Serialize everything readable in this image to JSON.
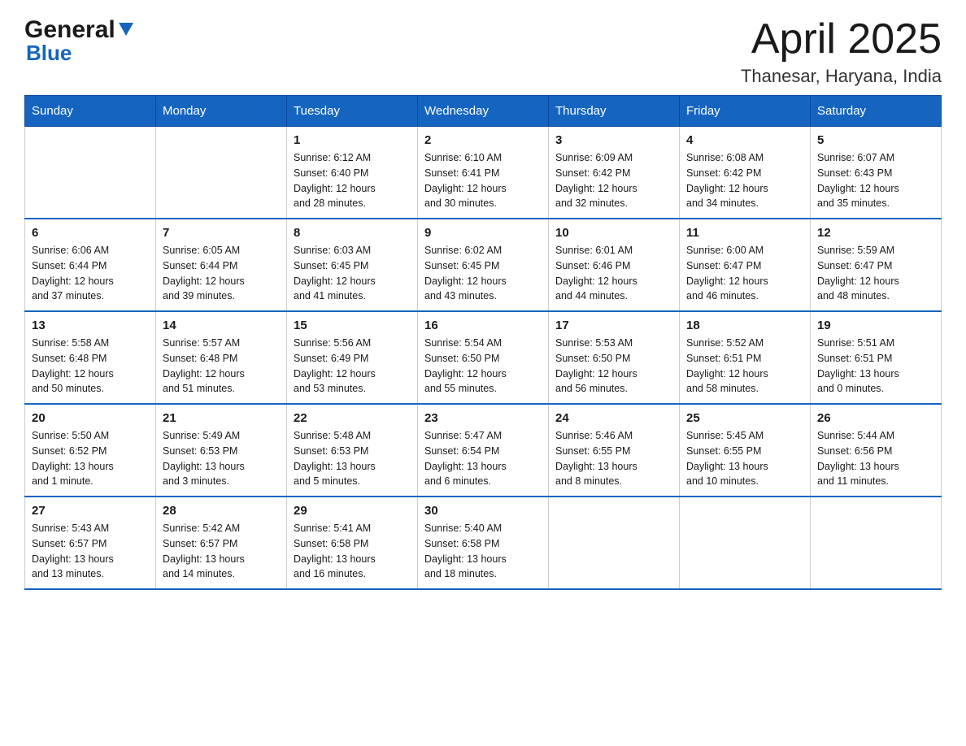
{
  "header": {
    "logo_general": "General",
    "logo_blue": "Blue",
    "title": "April 2025",
    "subtitle": "Thanesar, Haryana, India"
  },
  "calendar": {
    "days_of_week": [
      "Sunday",
      "Monday",
      "Tuesday",
      "Wednesday",
      "Thursday",
      "Friday",
      "Saturday"
    ],
    "weeks": [
      [
        {
          "day": "",
          "info": ""
        },
        {
          "day": "",
          "info": ""
        },
        {
          "day": "1",
          "info": "Sunrise: 6:12 AM\nSunset: 6:40 PM\nDaylight: 12 hours\nand 28 minutes."
        },
        {
          "day": "2",
          "info": "Sunrise: 6:10 AM\nSunset: 6:41 PM\nDaylight: 12 hours\nand 30 minutes."
        },
        {
          "day": "3",
          "info": "Sunrise: 6:09 AM\nSunset: 6:42 PM\nDaylight: 12 hours\nand 32 minutes."
        },
        {
          "day": "4",
          "info": "Sunrise: 6:08 AM\nSunset: 6:42 PM\nDaylight: 12 hours\nand 34 minutes."
        },
        {
          "day": "5",
          "info": "Sunrise: 6:07 AM\nSunset: 6:43 PM\nDaylight: 12 hours\nand 35 minutes."
        }
      ],
      [
        {
          "day": "6",
          "info": "Sunrise: 6:06 AM\nSunset: 6:44 PM\nDaylight: 12 hours\nand 37 minutes."
        },
        {
          "day": "7",
          "info": "Sunrise: 6:05 AM\nSunset: 6:44 PM\nDaylight: 12 hours\nand 39 minutes."
        },
        {
          "day": "8",
          "info": "Sunrise: 6:03 AM\nSunset: 6:45 PM\nDaylight: 12 hours\nand 41 minutes."
        },
        {
          "day": "9",
          "info": "Sunrise: 6:02 AM\nSunset: 6:45 PM\nDaylight: 12 hours\nand 43 minutes."
        },
        {
          "day": "10",
          "info": "Sunrise: 6:01 AM\nSunset: 6:46 PM\nDaylight: 12 hours\nand 44 minutes."
        },
        {
          "day": "11",
          "info": "Sunrise: 6:00 AM\nSunset: 6:47 PM\nDaylight: 12 hours\nand 46 minutes."
        },
        {
          "day": "12",
          "info": "Sunrise: 5:59 AM\nSunset: 6:47 PM\nDaylight: 12 hours\nand 48 minutes."
        }
      ],
      [
        {
          "day": "13",
          "info": "Sunrise: 5:58 AM\nSunset: 6:48 PM\nDaylight: 12 hours\nand 50 minutes."
        },
        {
          "day": "14",
          "info": "Sunrise: 5:57 AM\nSunset: 6:48 PM\nDaylight: 12 hours\nand 51 minutes."
        },
        {
          "day": "15",
          "info": "Sunrise: 5:56 AM\nSunset: 6:49 PM\nDaylight: 12 hours\nand 53 minutes."
        },
        {
          "day": "16",
          "info": "Sunrise: 5:54 AM\nSunset: 6:50 PM\nDaylight: 12 hours\nand 55 minutes."
        },
        {
          "day": "17",
          "info": "Sunrise: 5:53 AM\nSunset: 6:50 PM\nDaylight: 12 hours\nand 56 minutes."
        },
        {
          "day": "18",
          "info": "Sunrise: 5:52 AM\nSunset: 6:51 PM\nDaylight: 12 hours\nand 58 minutes."
        },
        {
          "day": "19",
          "info": "Sunrise: 5:51 AM\nSunset: 6:51 PM\nDaylight: 13 hours\nand 0 minutes."
        }
      ],
      [
        {
          "day": "20",
          "info": "Sunrise: 5:50 AM\nSunset: 6:52 PM\nDaylight: 13 hours\nand 1 minute."
        },
        {
          "day": "21",
          "info": "Sunrise: 5:49 AM\nSunset: 6:53 PM\nDaylight: 13 hours\nand 3 minutes."
        },
        {
          "day": "22",
          "info": "Sunrise: 5:48 AM\nSunset: 6:53 PM\nDaylight: 13 hours\nand 5 minutes."
        },
        {
          "day": "23",
          "info": "Sunrise: 5:47 AM\nSunset: 6:54 PM\nDaylight: 13 hours\nand 6 minutes."
        },
        {
          "day": "24",
          "info": "Sunrise: 5:46 AM\nSunset: 6:55 PM\nDaylight: 13 hours\nand 8 minutes."
        },
        {
          "day": "25",
          "info": "Sunrise: 5:45 AM\nSunset: 6:55 PM\nDaylight: 13 hours\nand 10 minutes."
        },
        {
          "day": "26",
          "info": "Sunrise: 5:44 AM\nSunset: 6:56 PM\nDaylight: 13 hours\nand 11 minutes."
        }
      ],
      [
        {
          "day": "27",
          "info": "Sunrise: 5:43 AM\nSunset: 6:57 PM\nDaylight: 13 hours\nand 13 minutes."
        },
        {
          "day": "28",
          "info": "Sunrise: 5:42 AM\nSunset: 6:57 PM\nDaylight: 13 hours\nand 14 minutes."
        },
        {
          "day": "29",
          "info": "Sunrise: 5:41 AM\nSunset: 6:58 PM\nDaylight: 13 hours\nand 16 minutes."
        },
        {
          "day": "30",
          "info": "Sunrise: 5:40 AM\nSunset: 6:58 PM\nDaylight: 13 hours\nand 18 minutes."
        },
        {
          "day": "",
          "info": ""
        },
        {
          "day": "",
          "info": ""
        },
        {
          "day": "",
          "info": ""
        }
      ]
    ]
  }
}
